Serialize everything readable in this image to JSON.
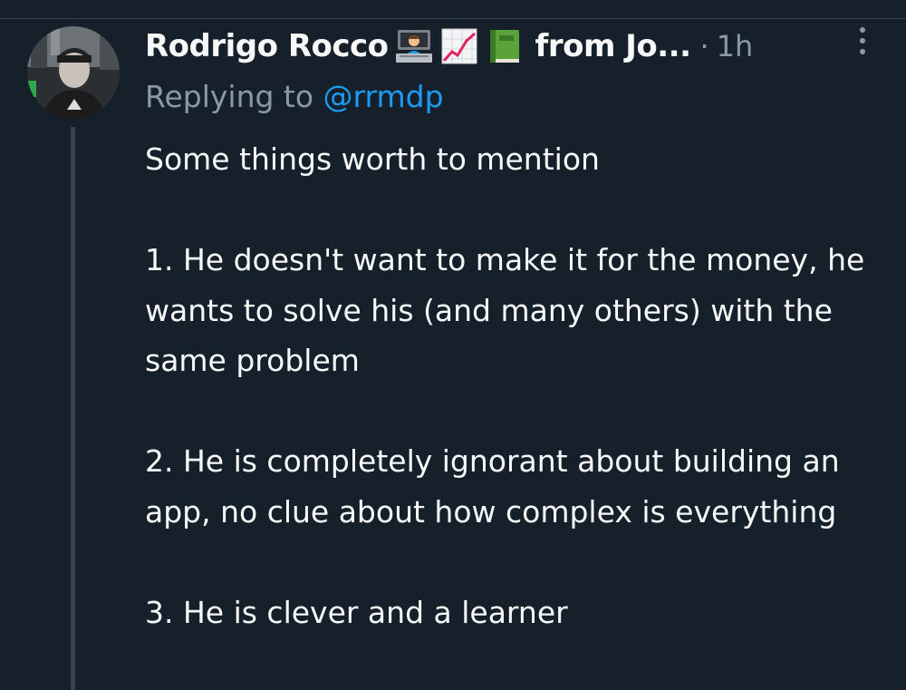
{
  "tweet": {
    "author_name": "Rodrigo Rocco",
    "name_emojis": [
      "technologist-icon",
      "chart-increasing-icon",
      "green-book-icon"
    ],
    "name_suffix": "from Jo...",
    "separator": "·",
    "time": "1h",
    "reply_prefix": "Replying to",
    "reply_handle": "@rrmdp",
    "paragraphs": [
      "Some things worth to mention",
      "1. He doesn't want to make it for the money, he wants to solve his (and many others) with the same problem",
      "2. He is completely ignorant about building an app, no clue about how complex is everything",
      "3. He is clever and a learner"
    ]
  },
  "colors": {
    "background": "#15202b",
    "text": "#f7f9f9",
    "muted": "#8b98a5",
    "link": "#1d9bf0",
    "divider": "#38444d"
  }
}
